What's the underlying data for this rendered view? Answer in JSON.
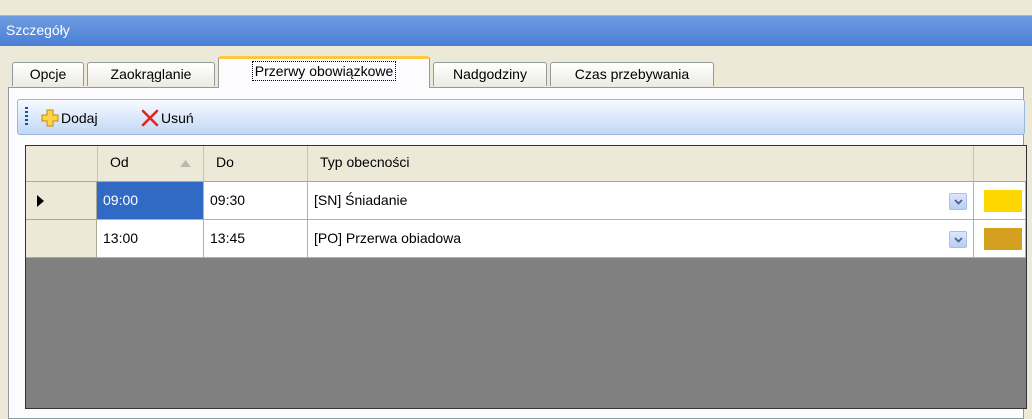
{
  "window": {
    "title": "Szczegóły"
  },
  "tabs": [
    {
      "label": "Opcje",
      "active": false
    },
    {
      "label": "Zaokrąglanie",
      "active": false
    },
    {
      "label": "Przerwy obowiązkowe",
      "active": true
    },
    {
      "label": "Nadgodziny",
      "active": false
    },
    {
      "label": "Czas przebywania",
      "active": false
    }
  ],
  "toolbar": {
    "add_label": "Dodaj",
    "delete_label": "Usuń"
  },
  "grid": {
    "columns": {
      "from": "Od",
      "to": "Do",
      "type": "Typ obecności"
    },
    "sort": {
      "column": "from",
      "direction": "ascending"
    },
    "rows": [
      {
        "from": "09:00",
        "to": "09:30",
        "type": "[SN]  Śniadanie",
        "color": "#ffd700",
        "current": true
      },
      {
        "from": "13:00",
        "to": "13:45",
        "type": "[PO]  Przerwa obiadowa",
        "color": "#d4a020",
        "current": false
      }
    ]
  },
  "colors": {
    "accent": "#4a7fd6",
    "selection": "#316ac5",
    "tab_highlight": "#ffc83c"
  }
}
